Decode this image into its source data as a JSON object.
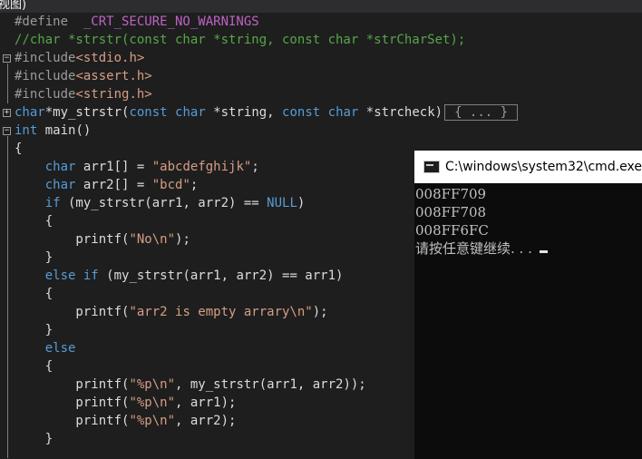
{
  "window": {
    "title_fragment": "视图)"
  },
  "editor": {
    "lines": [
      {
        "id": "define",
        "tokens": [
          [
            "pp",
            "#define  "
          ],
          [
            "mac",
            "_CRT_SECURE_NO_WARNINGS"
          ]
        ]
      },
      {
        "id": "comment",
        "tokens": [
          [
            "cm",
            "//char *strstr(const char *string, const char *strCharSet);"
          ]
        ]
      },
      {
        "id": "inc1",
        "tokens": [
          [
            "pp",
            "#include"
          ],
          [
            "hdr",
            "<stdio.h>"
          ]
        ]
      },
      {
        "id": "inc2",
        "tokens": [
          [
            "pp",
            "#include"
          ],
          [
            "hdr",
            "<assert.h>"
          ]
        ]
      },
      {
        "id": "inc3",
        "tokens": [
          [
            "pp",
            "#include"
          ],
          [
            "hdr",
            "<string.h>"
          ]
        ]
      },
      {
        "id": "mystrstr",
        "tokens": [
          [
            "kw",
            "char"
          ],
          [
            "fn",
            "*my_strstr("
          ],
          [
            "kw",
            "const"
          ],
          [
            "fn",
            " "
          ],
          [
            "kw",
            "char"
          ],
          [
            "fn",
            " *string, "
          ],
          [
            "kw",
            "const"
          ],
          [
            "fn",
            " "
          ],
          [
            "kw",
            "char"
          ],
          [
            "fn",
            " *strcheck)"
          ]
        ],
        "collapsed": "{ ... }"
      },
      {
        "id": "main",
        "tokens": [
          [
            "kw",
            "int"
          ],
          [
            "fn",
            " main()"
          ]
        ]
      },
      {
        "id": "brace-open",
        "tokens": [
          [
            "fn",
            "{"
          ]
        ]
      },
      {
        "id": "arr1",
        "tokens": [
          [
            "fn",
            "    "
          ],
          [
            "kw",
            "char"
          ],
          [
            "fn",
            " arr1[] = "
          ],
          [
            "str",
            "\"abcdefghijk\""
          ],
          [
            "fn",
            ";"
          ]
        ]
      },
      {
        "id": "arr2",
        "tokens": [
          [
            "fn",
            "    "
          ],
          [
            "kw",
            "char"
          ],
          [
            "fn",
            " arr2[] = "
          ],
          [
            "str",
            "\"bcd\""
          ],
          [
            "fn",
            ";"
          ]
        ]
      },
      {
        "id": "if1",
        "tokens": [
          [
            "fn",
            "    "
          ],
          [
            "kw",
            "if"
          ],
          [
            "fn",
            " (my_strstr(arr1, arr2) == "
          ],
          [
            "kw",
            "NULL"
          ],
          [
            "fn",
            ")"
          ]
        ]
      },
      {
        "id": "if1-open",
        "tokens": [
          [
            "fn",
            "    {"
          ]
        ]
      },
      {
        "id": "printf-no",
        "tokens": [
          [
            "fn",
            "        printf("
          ],
          [
            "str",
            "\"No\\n\""
          ],
          [
            "fn",
            ");"
          ]
        ]
      },
      {
        "id": "if1-close",
        "tokens": [
          [
            "fn",
            "    }"
          ]
        ]
      },
      {
        "id": "elseif",
        "tokens": [
          [
            "fn",
            "    "
          ],
          [
            "kw",
            "else"
          ],
          [
            "fn",
            " "
          ],
          [
            "kw",
            "if"
          ],
          [
            "fn",
            " (my_strstr(arr1, arr2) == arr1)"
          ]
        ]
      },
      {
        "id": "elseif-open",
        "tokens": [
          [
            "fn",
            "    {"
          ]
        ]
      },
      {
        "id": "printf-empty",
        "tokens": [
          [
            "fn",
            "        printf("
          ],
          [
            "str",
            "\"arr2 is empty arrary\\n\""
          ],
          [
            "fn",
            ");"
          ]
        ]
      },
      {
        "id": "elseif-close",
        "tokens": [
          [
            "fn",
            "    }"
          ]
        ]
      },
      {
        "id": "else",
        "tokens": [
          [
            "fn",
            "    "
          ],
          [
            "kw",
            "else"
          ]
        ]
      },
      {
        "id": "else-open",
        "tokens": [
          [
            "fn",
            "    {"
          ]
        ]
      },
      {
        "id": "printf-p1",
        "tokens": [
          [
            "fn",
            "        printf("
          ],
          [
            "str",
            "\"%p\\n\""
          ],
          [
            "fn",
            ", my_strstr(arr1, arr2));"
          ]
        ]
      },
      {
        "id": "printf-p2",
        "tokens": [
          [
            "fn",
            "        printf("
          ],
          [
            "str",
            "\"%p\\n\""
          ],
          [
            "fn",
            ", arr1);"
          ]
        ]
      },
      {
        "id": "printf-p3",
        "tokens": [
          [
            "fn",
            "        printf("
          ],
          [
            "str",
            "\"%p\\n\""
          ],
          [
            "fn",
            ", arr2);"
          ]
        ]
      },
      {
        "id": "else-close",
        "tokens": [
          [
            "fn",
            "    }"
          ]
        ]
      }
    ]
  },
  "console": {
    "title": "C:\\windows\\system32\\cmd.exe",
    "lines": [
      "008FF709",
      "008FF708",
      "008FF6FC"
    ],
    "prompt": "请按任意键继续. . ."
  },
  "colors": {
    "editor_bg": "#1e1e1e",
    "keyword": "#569cd6",
    "string": "#d69d85",
    "comment": "#57a64a",
    "macro": "#be63c5",
    "console_bg": "#0c0c0c",
    "console_text": "#c0c0c0"
  }
}
